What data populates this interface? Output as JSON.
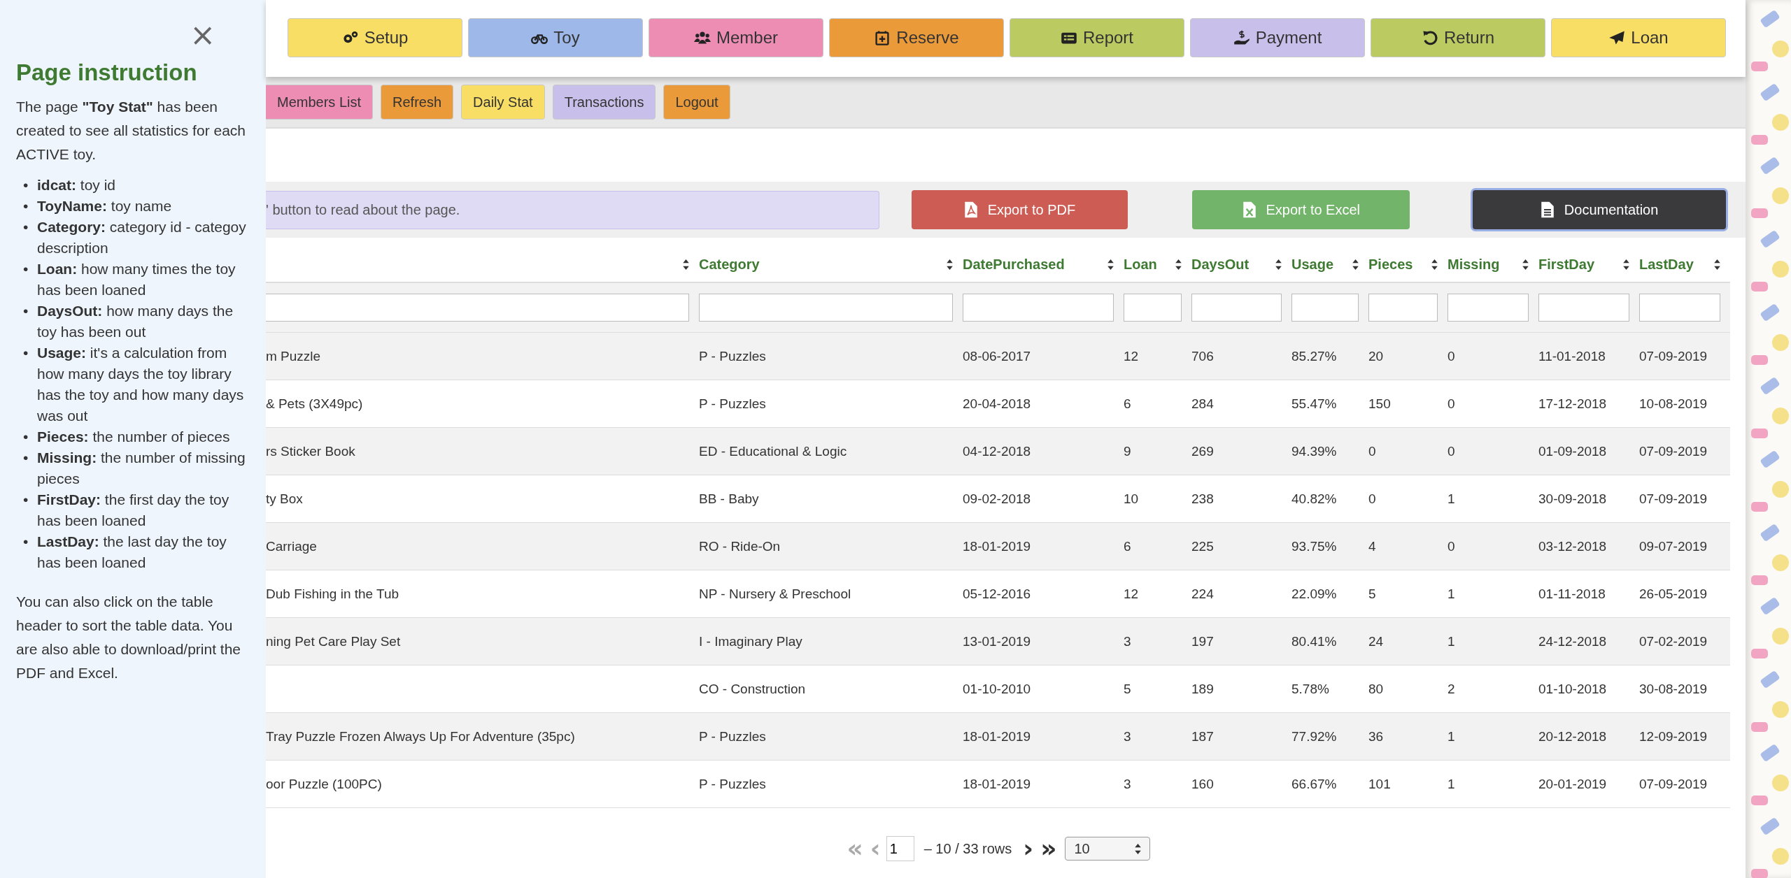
{
  "instructions": {
    "close": "×",
    "title": "Page instruction",
    "intro": "The page **\"Toy Stat\"** has been created to see all statistics for each ACTIVE toy.",
    "items": [
      {
        "marker": "•",
        "text": "**idcat:** toy id"
      },
      {
        "marker": "•",
        "text": "**ToyName:** toy name"
      },
      {
        "marker": "•",
        "text": "**Category:** category id - categoy description"
      },
      {
        "marker": "•",
        "text": "**Loan:** how many times the toy has been loaned"
      },
      {
        "marker": "•",
        "text": "**DaysOut:** how many days the toy has been out"
      },
      {
        "marker": "•",
        "text": "**Usage:** it's a calculation from how many days the toy library has the toy and how many days was out"
      },
      {
        "marker": "•",
        "text": "**Pieces:** the number of pieces"
      },
      {
        "marker": "•",
        "text": "**Missing:** the number of missing pieces"
      },
      {
        "marker": "•",
        "text": "**FirstDay:** the first day the toy has been loaned"
      },
      {
        "marker": "•",
        "text": "**LastDay:** the last day the toy has been loaned"
      }
    ],
    "outro": "You can also click on the table header to sort the table data. You are also able to download/print the PDF and Excel."
  },
  "main_nav": [
    {
      "label": "Setup",
      "color": "#f9de66"
    },
    {
      "label": "Toy",
      "color": "#9db8e9"
    },
    {
      "label": "Member",
      "color": "#ee8db4"
    },
    {
      "label": "Reserve",
      "color": "#eb9a3a"
    },
    {
      "label": "Report",
      "color": "#bbcb62"
    },
    {
      "label": "Payment",
      "color": "#c8c0eb"
    },
    {
      "label": "Return",
      "color": "#bbcb62"
    },
    {
      "label": "Loan",
      "color": "#f9de66"
    }
  ],
  "sub_nav": [
    {
      "label": "Members List",
      "color": "#ee8db4"
    },
    {
      "label": "Refresh",
      "color": "#eb9a3a"
    },
    {
      "label": "Daily Stat",
      "color": "#f9de66"
    },
    {
      "label": "Transactions",
      "color": "#c8c0eb"
    },
    {
      "label": "Logout",
      "color": "#eb9a3a"
    }
  ],
  "info": "' button to read about the page.",
  "actions": [
    {
      "kind": "pdf",
      "label": "Export to PDF",
      "focused": false
    },
    {
      "kind": "excel",
      "label": "Export to Excel",
      "focused": false
    },
    {
      "kind": "doc",
      "label": "Documentation",
      "focused": true
    }
  ],
  "table": {
    "columns": [
      {},
      {
        "label": "Category"
      },
      {
        "label": "DatePurchased"
      },
      {
        "label": "Loan"
      },
      {
        "label": "DaysOut"
      },
      {
        "label": "Usage"
      },
      {
        "label": "Pieces"
      },
      {
        "label": "Missing"
      },
      {
        "label": "FirstDay"
      },
      {
        "label": "LastDay"
      }
    ],
    "rows": [
      [
        "m Puzzle",
        "P - Puzzles",
        "08-06-2017",
        "12",
        "706",
        "85.27%",
        "20",
        "0",
        "11-01-2018",
        "07-09-2019"
      ],
      [
        "& Pets (3X49pc)",
        "P - Puzzles",
        "20-04-2018",
        "6",
        "284",
        "55.47%",
        "150",
        "0",
        "17-12-2018",
        "10-08-2019"
      ],
      [
        "rs Sticker Book",
        "ED - Educational & Logic",
        "04-12-2018",
        "9",
        "269",
        "94.39%",
        "0",
        "0",
        "01-09-2018",
        "07-09-2019"
      ],
      [
        "ty Box",
        "BB - Baby",
        "09-02-2018",
        "10",
        "238",
        "40.82%",
        "0",
        "1",
        "30-09-2018",
        "07-09-2019"
      ],
      [
        "Carriage",
        "RO - Ride-On",
        "18-01-2019",
        "6",
        "225",
        "93.75%",
        "4",
        "0",
        "03-12-2018",
        "09-07-2019"
      ],
      [
        "Dub Fishing in the Tub",
        "NP - Nursery & Preschool",
        "05-12-2016",
        "12",
        "224",
        "22.09%",
        "5",
        "1",
        "01-11-2018",
        "26-05-2019"
      ],
      [
        "ning Pet Care Play Set",
        "I - Imaginary Play",
        "13-01-2019",
        "3",
        "197",
        "80.41%",
        "24",
        "1",
        "24-12-2018",
        "07-02-2019"
      ],
      [
        "",
        "CO - Construction",
        "01-10-2010",
        "5",
        "189",
        "5.78%",
        "80",
        "2",
        "01-10-2018",
        "30-08-2019"
      ],
      [
        "Tray Puzzle Frozen Always Up For Adventure (35pc)",
        "P - Puzzles",
        "18-01-2019",
        "3",
        "187",
        "77.92%",
        "36",
        "1",
        "20-12-2018",
        "12-09-2019"
      ],
      [
        "oor Puzzle (100PC)",
        "P - Puzzles",
        "18-01-2019",
        "3",
        "160",
        "66.67%",
        "101",
        "1",
        "20-01-2019",
        "07-09-2019"
      ]
    ]
  },
  "pager": {
    "first": {
      "label": "«",
      "disabled": true
    },
    "prev": {
      "label": "‹",
      "disabled": true
    },
    "page": "1",
    "range": "– 10 / 33 rows",
    "next": {
      "label": "›",
      "disabled": false
    },
    "last": {
      "label": "»",
      "disabled": false
    },
    "page_size": "10"
  }
}
